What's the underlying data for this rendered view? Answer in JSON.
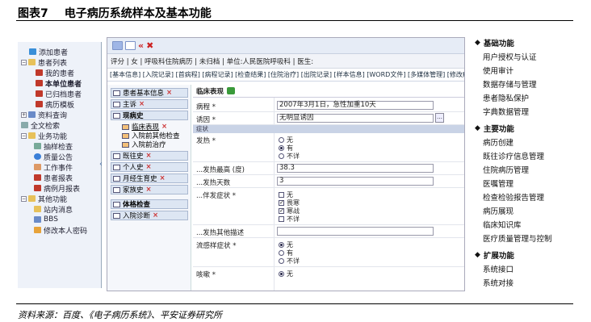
{
  "figure": {
    "label": "图表7",
    "title": "电子病历系统样本及基本功能",
    "source": "资料来源：百度、《电子病历系统》、平安证券研究所"
  },
  "tree": [
    {
      "label": "添加患者"
    },
    {
      "label": "患者列表"
    },
    {
      "label": "我的患者"
    },
    {
      "label": "本单位患者"
    },
    {
      "label": "已归档患者"
    },
    {
      "label": "病历模板"
    },
    {
      "label": "资料查询"
    },
    {
      "label": "全文检索"
    },
    {
      "label": "业务功能"
    },
    {
      "label": "抽样检查"
    },
    {
      "label": "质量公告"
    },
    {
      "label": "工作事件"
    },
    {
      "label": "患者报表"
    },
    {
      "label": "病例月报表"
    },
    {
      "label": "其他功能"
    },
    {
      "label": "站内消息"
    },
    {
      "label": "BBS"
    },
    {
      "label": "修改本人密码"
    }
  ],
  "app": {
    "infobar": "评分 | 女 | 呼吸科住院病历 | 未归档 | 单位:人民医院呼吸科 | 医生:",
    "tabs": "[基本信息] [入院记录] [首病程] [病程记录] [检查结果] [住院治疗] [出院记录] [样本信息] [WORD文件] [多媒体管理] [修改痕迹]",
    "sections": [
      {
        "label": "患者基本信息"
      },
      {
        "label": "主诉"
      },
      {
        "label": "现病史"
      },
      {
        "label": "临床表现"
      },
      {
        "label": "入院前其他检查"
      },
      {
        "label": "入院前治疗"
      },
      {
        "label": "既往史"
      },
      {
        "label": "个人史"
      },
      {
        "label": "月经生育史"
      },
      {
        "label": "家族史"
      },
      {
        "label": "体格检查"
      },
      {
        "label": "入院诊断"
      }
    ],
    "form": {
      "heading": "临床表现",
      "course_label": "病程 *",
      "course_value": "2007年3月1日，急性加重10天",
      "cause_label": "诱因 *",
      "cause_value": "无明显诱因",
      "group_symptom": "症状",
      "fever_label": "发热 *",
      "opt_none": "无",
      "opt_yes": "有",
      "opt_unclear": "不详",
      "maxtemp_label": "...发热最高 (度)",
      "maxtemp_value": "38.3",
      "days_label": "...发热天数",
      "days_value": "3",
      "accompany_label": "...伴发症状 *",
      "chk_none": "无",
      "chk_aversion": "畏寒",
      "chk_chill": "寒战",
      "chk_unclear": "不详",
      "other_desc_label": "...发热其他描述",
      "flu_label": "流感样症状 *",
      "cough_label": "咳嗽 *"
    }
  },
  "features": {
    "basic_title": "基础功能",
    "basic": [
      "用户授权与认证",
      "使用审计",
      "数据存储与管理",
      "患者隐私保护",
      "字典数据管理"
    ],
    "main_title": "主要功能",
    "main": [
      "病历创建",
      "既往诊疗信息管理",
      "住院病历管理",
      "医嘱管理",
      "检查检验报告管理",
      "病历展现",
      "临床知识库",
      "医疗质量管理与控制"
    ],
    "ext_title": "扩展功能",
    "ext": [
      "系统接口",
      "系统对接"
    ]
  },
  "colors": {
    "accent": "#2f4f8f",
    "tree_bg": "#eef2f9",
    "section_bg": "#dde6f3"
  }
}
